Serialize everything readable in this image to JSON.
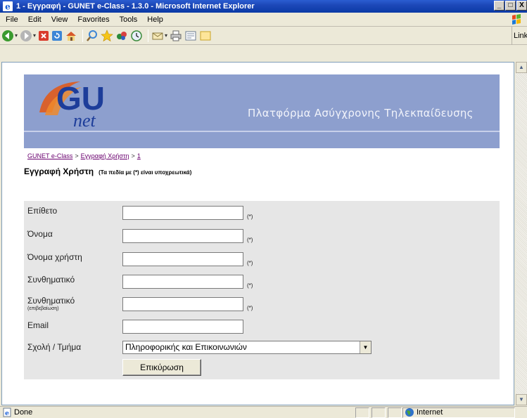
{
  "window": {
    "title": "1 - Εγγραφή - GUNET e-Class - 1.3.0 - Microsoft Internet Explorer",
    "controls": [
      "_",
      "□",
      "X"
    ]
  },
  "menubar": {
    "items": [
      "File",
      "Edit",
      "View",
      "Favorites",
      "Tools",
      "Help"
    ]
  },
  "toolbar": {
    "links_label": "Links",
    "buttons": [
      "back-icon",
      "forward-icon",
      "stop-icon",
      "refresh-icon",
      "home-icon",
      "search-icon",
      "favorites-icon",
      "media-icon",
      "history-icon",
      "mail-icon",
      "print-icon",
      "edit-icon",
      "messenger-icon"
    ]
  },
  "banner": {
    "logo_text_main": "GU",
    "logo_text_sub": "net",
    "tagline": "Πλατφόρμα Ασύγχρονης Τηλεκπαίδευσης"
  },
  "breadcrumb": {
    "items": [
      "GUNET e-Class",
      "Εγγραφή Χρήστη",
      "1"
    ],
    "separator": ">"
  },
  "page": {
    "heading": "Εγγραφή Χρήστη",
    "note": "(Τα πεδία με (*) είναι υποχρεωτικά)"
  },
  "form": {
    "fields": [
      {
        "label": "Επίθετο",
        "sublabel": "",
        "value": "",
        "required": "(*)"
      },
      {
        "label": "Όνομα",
        "sublabel": "",
        "value": "",
        "required": "(*)"
      },
      {
        "label": "Όνομα χρήστη",
        "sublabel": "",
        "value": "",
        "required": "(*)"
      },
      {
        "label": "Συνθηματικό",
        "sublabel": "",
        "value": "",
        "required": "(*)"
      },
      {
        "label": "Συνθηματικό",
        "sublabel": "(επιβεβαίωση)",
        "value": "",
        "required": "(*)"
      },
      {
        "label": "Email",
        "sublabel": "",
        "value": "",
        "required": ""
      }
    ],
    "department": {
      "label": "Σχολή / Τμήμα",
      "selected": "Πληροφορικής και Επικοινωνιών"
    },
    "submit_label": "Επικύρωση"
  },
  "statusbar": {
    "text": "Done",
    "zone": "Internet"
  },
  "colors": {
    "title_bar": "#0a3aa6",
    "banner": "#8d9fce",
    "form_panel": "#e6e6e6",
    "link": "#6a006f"
  }
}
